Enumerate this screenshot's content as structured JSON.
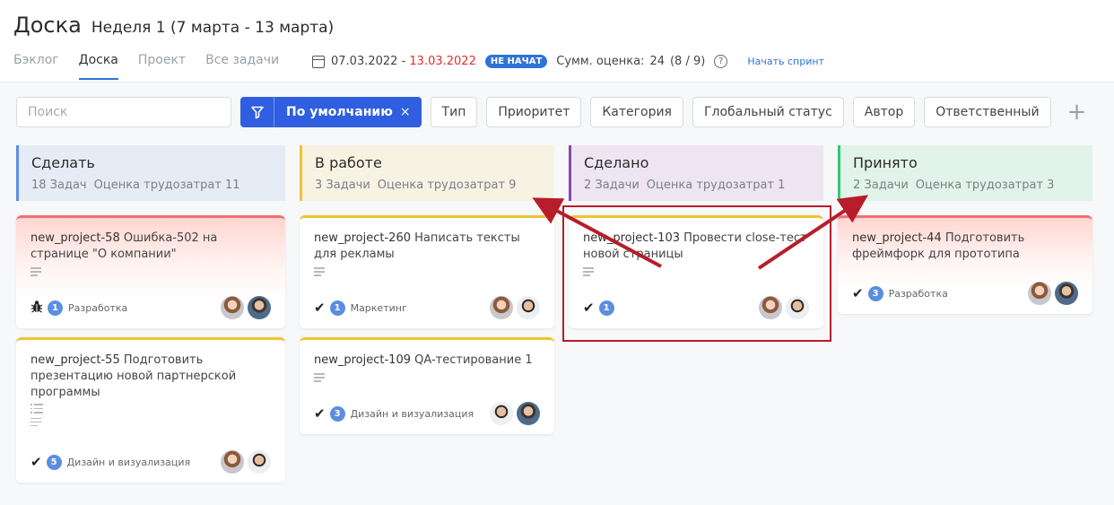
{
  "header": {
    "title": "Доска",
    "week": "Неделя 1 (7 марта - 13 марта)"
  },
  "tabs": [
    {
      "label": "Бэклог",
      "active": false
    },
    {
      "label": "Доска",
      "active": true
    },
    {
      "label": "Проект",
      "active": false
    },
    {
      "label": "Все задачи",
      "active": false
    }
  ],
  "sprint": {
    "start": "07.03.2022",
    "separator": " - ",
    "end": "13.03.2022",
    "status": "НЕ НАЧАТ",
    "sum_label": "Сумм. оценка:",
    "sum_value": "24",
    "sum_ratio": "(8 / 9)",
    "help": "?",
    "start_link": "Начать спринт"
  },
  "filters": {
    "search_placeholder": "Поиск",
    "default_label": "По умолчанию",
    "default_close": "×",
    "buttons": [
      "Тип",
      "Приоритет",
      "Категория",
      "Глобальный статус",
      "Автор",
      "Ответственный"
    ],
    "add": "+"
  },
  "columns": [
    {
      "name": "Сделать",
      "tasks": "18 Задач",
      "estimate": "Оценка трудозатрат 11",
      "color": "#5b8ee0",
      "bg": "#e6ecf5"
    },
    {
      "name": "В работе",
      "tasks": "3 Задачи",
      "estimate": "Оценка трудозатрат 9",
      "color": "#f2c230",
      "bg": "#f7f3e3"
    },
    {
      "name": "Сделано",
      "tasks": "2 Задачи",
      "estimate": "Оценка трудозатрат 1",
      "color": "#8e44ad",
      "bg": "#ede6f2"
    },
    {
      "name": "Принято",
      "tasks": "2 Задачи",
      "estimate": "Оценка трудозатрат 3",
      "color": "#2ecc71",
      "bg": "#e2f3ea"
    }
  ],
  "cards": [
    {
      "key": "new_project-58",
      "title": "Ошибка-502 на странице \"О компании\"",
      "type_icon": "bug-icon",
      "count": "1",
      "category": "Разработка"
    },
    {
      "key": "new_project-55",
      "title": "Подготовить презентацию новой партнерской программы",
      "type_icon": "check-icon",
      "count": "5",
      "category": "Дизайн и визуализация"
    },
    {
      "key": "new_project-260",
      "title": "Написать тексты для рекламы",
      "type_icon": "check-icon",
      "count": "1",
      "category": "Маркетинг"
    },
    {
      "key": "new_project-109",
      "title": "QA-тестирование 1",
      "type_icon": "check-icon",
      "count": "3",
      "category": "Дизайн и визуализация"
    },
    {
      "key": "new_project-103",
      "title": "Провести close-тест новой страницы",
      "type_icon": "check-icon",
      "count": "1",
      "category": ""
    },
    {
      "key": "new_project-44",
      "title": "Подготовить фреймфорк для прототипа",
      "type_icon": "check-icon",
      "count": "3",
      "category": "Разработка"
    }
  ],
  "colors": {
    "accent": "#2f5fe0",
    "annotation": "#b81d2a",
    "date_end": "#e03030"
  }
}
